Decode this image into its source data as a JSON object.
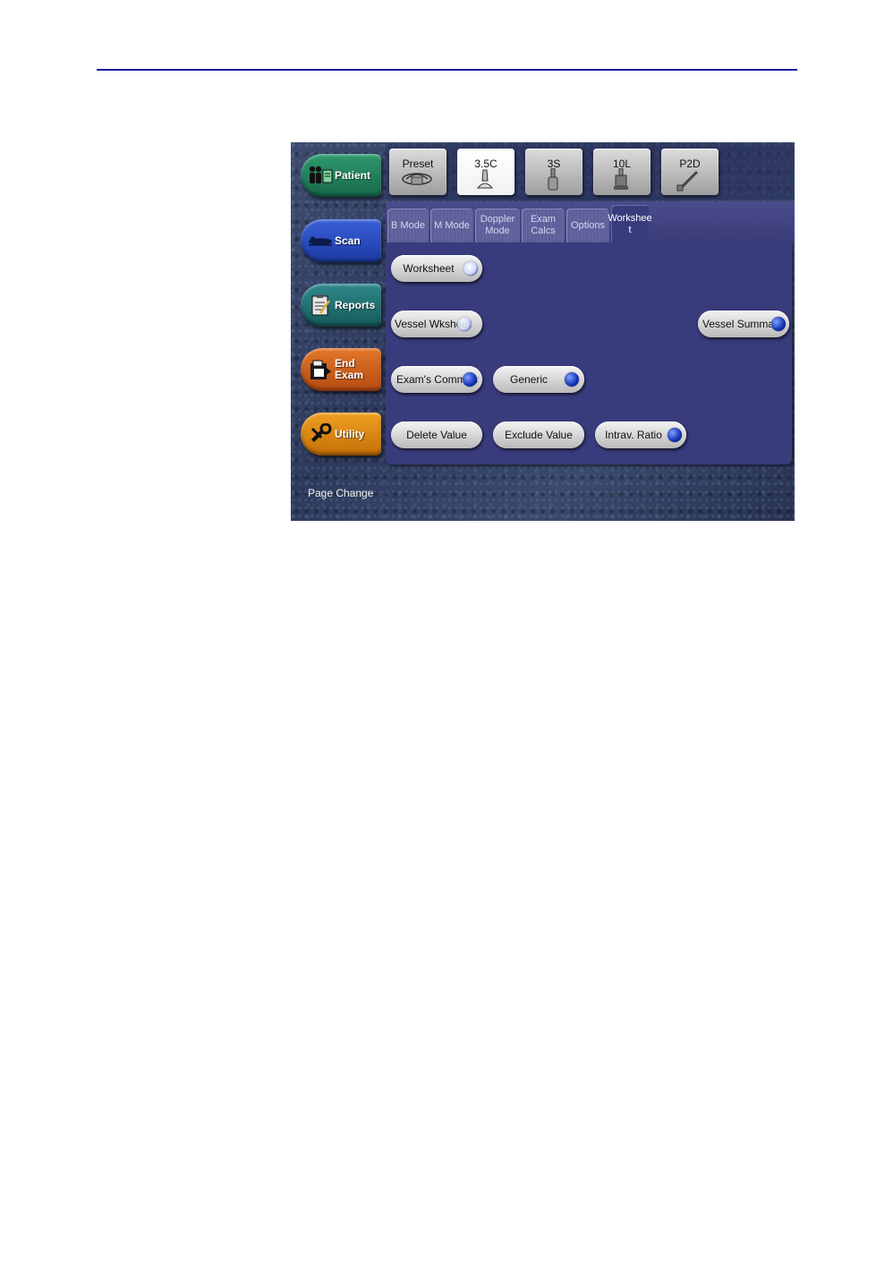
{
  "nav": {
    "patient": "Patient",
    "scan": "Scan",
    "reports": "Reports",
    "end_exam_1": "End",
    "end_exam_2": "Exam",
    "utility": "Utility",
    "page_change": "Page Change"
  },
  "probes": {
    "preset": "Preset",
    "p1": "3.5C",
    "p2": "3S",
    "p3": "10L",
    "p4": "P2D",
    "active": "3.5C"
  },
  "tabs": {
    "b_mode": "B Mode",
    "m_mode": "M Mode",
    "doppler_1": "Doppler",
    "doppler_2": "Mode",
    "exam_1": "Exam",
    "exam_2": "Calcs",
    "options": "Options",
    "worksheet_1": "Workshee",
    "worksheet_2": "t",
    "active": "Worksheet"
  },
  "buttons": {
    "worksheet": "Worksheet",
    "vessel_wksheet": "Vessel Wksheet",
    "vessel_summary": "Vessel Summary",
    "exams_comments": "Exam's Comments",
    "generic": "Generic",
    "delete_value": "Delete Value",
    "exclude_value": "Exclude Value",
    "intrav_ratio": "Intrav. Ratio"
  },
  "colors": {
    "rule": "#1a1aa6",
    "panel": "#393c7c",
    "dot": "#1232b4"
  }
}
